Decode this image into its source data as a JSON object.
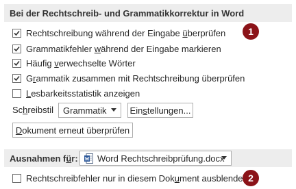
{
  "correction_section": {
    "title": "Bei der Rechtschreib- und Grammatikkorrektur in Word",
    "options": [
      {
        "pre": "Rechtschreibung während der Eingabe ",
        "u": "ü",
        "post": "berprüfen",
        "checked": true
      },
      {
        "pre": "Grammatikfehler ",
        "u": "w",
        "post": "ährend der Eingabe markieren",
        "checked": true
      },
      {
        "pre": "Häufig ",
        "u": "v",
        "post": "erwechselte Wörter",
        "checked": true
      },
      {
        "pre": "G",
        "u": "r",
        "post": "ammatik zusammen mit Rechtschreibung überprüfen",
        "checked": true
      },
      {
        "pre": "",
        "u": "L",
        "post": "esbarkeitsstatistik anzeigen",
        "checked": false
      }
    ],
    "style_label_pre": "Sc",
    "style_label_u": "h",
    "style_label_post": "reibstil",
    "style_value": "Grammatik",
    "settings_button_pre": "Ein",
    "settings_button_u": "s",
    "settings_button_post": "tellungen...",
    "recheck_button_pre": "",
    "recheck_button_u": "D",
    "recheck_button_post": "okument erneut überprüfen"
  },
  "exceptions_section": {
    "label_pre": "Ausnahmen f",
    "label_u": "ü",
    "label_post": "r:",
    "document_value": "Word Rechtschreibprüfung.docx",
    "document_icon": "word-document-icon",
    "options": [
      {
        "pre": "Rechtschreibfehler nur in diesem Dok",
        "u": "u",
        "post": "ment ausblenden",
        "checked": false
      }
    ]
  },
  "callouts": [
    "1",
    "2"
  ],
  "colors": {
    "callout": "#8b1318",
    "header_bg": "#ededed"
  }
}
